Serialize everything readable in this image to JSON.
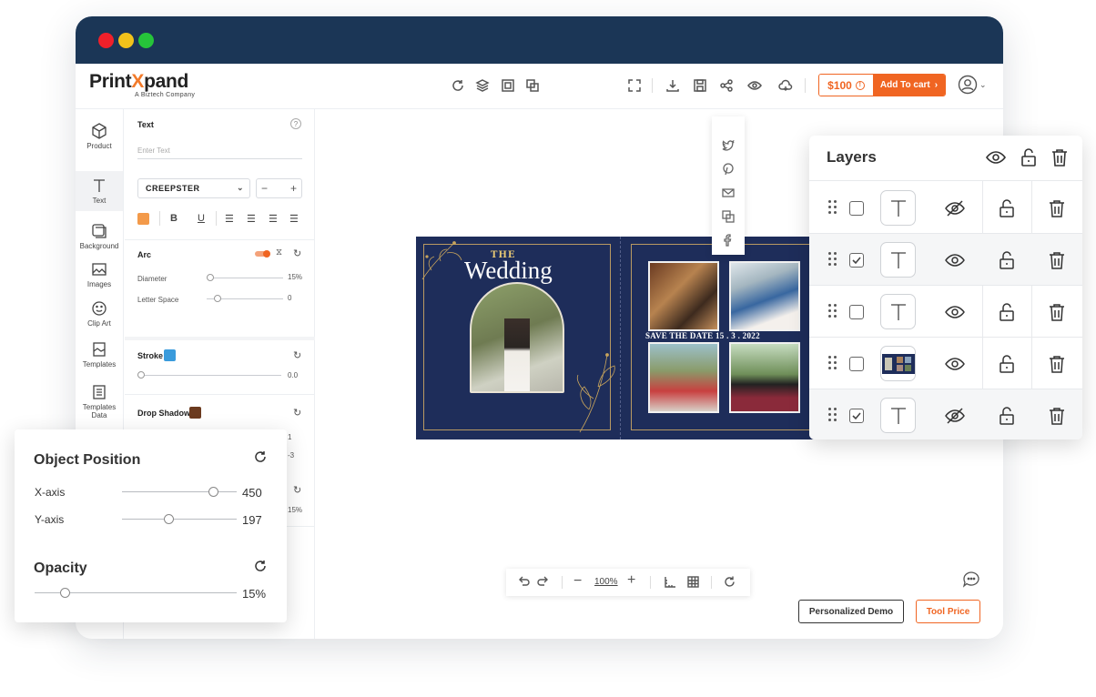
{
  "brand": {
    "name_part1": "Print",
    "name_x": "X",
    "name_part2": "pand",
    "tagline": "A Biztech Company"
  },
  "cart": {
    "price": "$100",
    "add_to_cart": "Add To cart"
  },
  "tools": [
    {
      "label": "Product",
      "icon": "cube-icon"
    },
    {
      "label": "Text",
      "icon": "text-icon"
    },
    {
      "label": "Background",
      "icon": "background-icon"
    },
    {
      "label": "Images",
      "icon": "image-icon"
    },
    {
      "label": "Clip Art",
      "icon": "smiley-icon"
    },
    {
      "label": "Templates",
      "icon": "templates-icon"
    },
    {
      "label": "Templates Data",
      "icon": "templates-data-icon"
    }
  ],
  "text_panel": {
    "title": "Text",
    "placeholder": "Enter Text",
    "font": "CREEPSTER",
    "size_minus": "−",
    "size_plus": "+",
    "color": "#f39a4a",
    "arc_label": "Arc",
    "diameter_label": "Diameter",
    "diameter_value": "15%",
    "letter_space_label": "Letter Space",
    "letter_space_value": "0",
    "stroke_label": "Stroke",
    "stroke_color": "#3a9bdc",
    "stroke_value": "0.0",
    "shadow_label": "Drop Shadow",
    "shadow_color": "#6b3a1f",
    "hidden_values": [
      "1",
      "-3",
      "15%"
    ]
  },
  "design": {
    "the": "THE",
    "title": "Wedding",
    "save_date": "SAVE THE DATE 15 . 3 . 2022"
  },
  "zoom": {
    "value": "100%"
  },
  "buttons": {
    "demo": "Personalized Demo",
    "tool_price": "Tool Price"
  },
  "layers": {
    "title": "Layers",
    "rows": [
      {
        "checked": false,
        "type": "text",
        "visible": false
      },
      {
        "checked": true,
        "type": "text",
        "visible": true
      },
      {
        "checked": false,
        "type": "text",
        "visible": true
      },
      {
        "checked": false,
        "type": "image",
        "visible": true
      },
      {
        "checked": true,
        "type": "text",
        "visible": false
      }
    ]
  },
  "object_position": {
    "title": "Object Position",
    "x_label": "X-axis",
    "x_value": "450",
    "y_label": "Y-axis",
    "y_value": "197",
    "opacity_title": "Opacity",
    "opacity_value": "15%"
  },
  "colors": {
    "navy": "#1b3656",
    "accent": "#f06522",
    "design_bg": "#1e2d5a"
  }
}
